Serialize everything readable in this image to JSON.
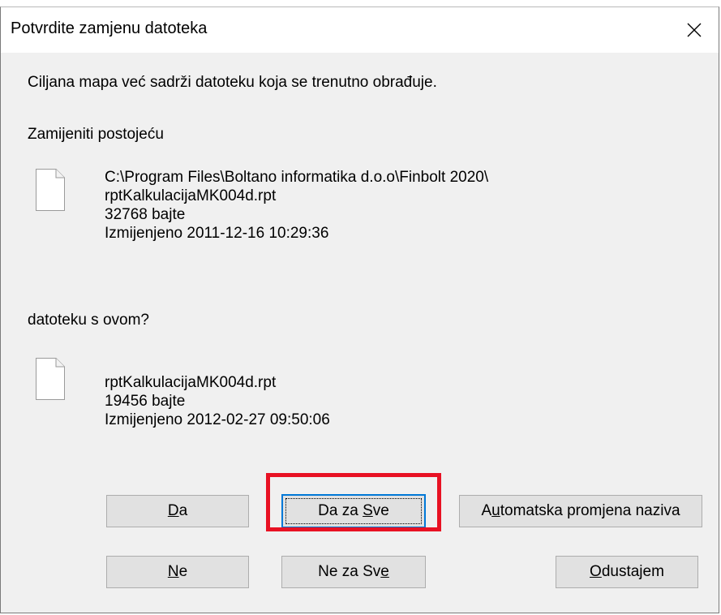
{
  "window": {
    "title": "Potvrdite zamjenu datoteka",
    "close_icon": "close-icon"
  },
  "message": "Ciljana mapa već sadrži datoteku koja se trenutno obrađuje.",
  "replace_label": "Zamijeniti postojeću",
  "existing_file": {
    "icon": "file-icon",
    "path": "C:\\Program Files\\Boltano informatika d.o.o\\Finbolt 2020\\",
    "name": "rptKalkulacijaMK004d.rpt",
    "size": "32768 bajte",
    "modified": "Izmijenjeno 2011-12-16 10:29:36"
  },
  "with_label": "datoteku s ovom?",
  "new_file": {
    "icon": "file-icon",
    "name": "rptKalkulacijaMK004d.rpt",
    "size": "19456 bajte",
    "modified": "Izmijenjeno 2012-02-27 09:50:06"
  },
  "buttons": {
    "yes": {
      "mnemonic": "D",
      "rest": "a"
    },
    "yes_all": {
      "before": "Da za ",
      "mnemonic": "S",
      "rest": "ve"
    },
    "auto_rename": {
      "before": "A",
      "mnemonic": "u",
      "rest": "tomatska promjena naziva"
    },
    "no": {
      "mnemonic": "N",
      "rest": "e"
    },
    "no_all": {
      "before": "Ne za Sv",
      "mnemonic": "e",
      "rest": ""
    },
    "cancel": {
      "mnemonic": "O",
      "rest": "dustajem"
    }
  },
  "colors": {
    "highlight": "#e81123",
    "default_button_border": "#0078d7"
  }
}
